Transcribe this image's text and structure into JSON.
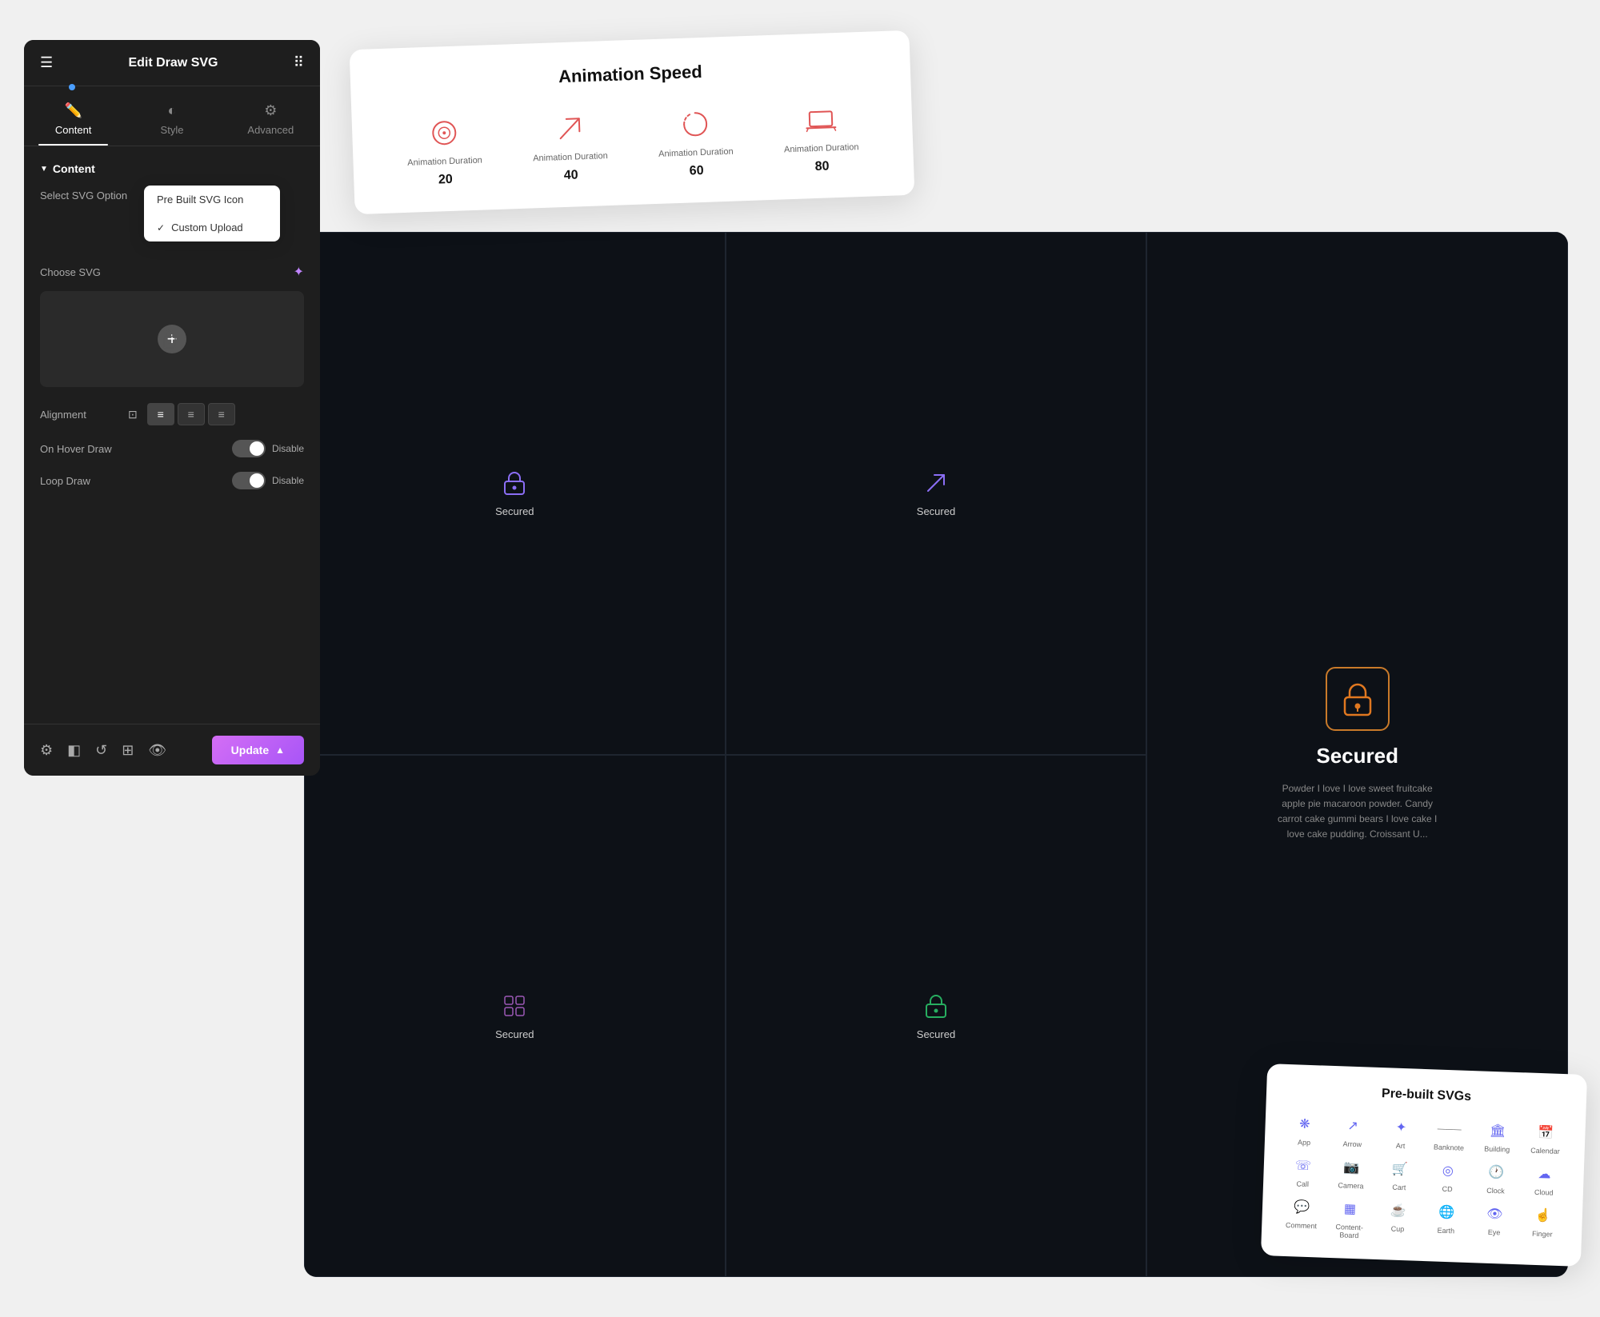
{
  "panel": {
    "title": "Edit Draw SVG",
    "tabs": [
      {
        "id": "content",
        "label": "Content",
        "icon": "✏️",
        "active": true
      },
      {
        "id": "style",
        "label": "Style",
        "icon": "◐"
      },
      {
        "id": "advanced",
        "label": "Advanced",
        "icon": "⚙️"
      }
    ],
    "content_section": {
      "title": "Content",
      "select_svg_label": "Select SVG Option",
      "dropdown_items": [
        {
          "label": "Pre Built SVG Icon",
          "selected": false
        },
        {
          "label": "Custom Upload",
          "selected": true
        }
      ],
      "choose_svg_label": "Choose SVG",
      "alignment_label": "Alignment",
      "alignment_options": [
        "left",
        "center",
        "right"
      ],
      "on_hover_draw_label": "On Hover Draw",
      "on_hover_draw_value": "Disable",
      "loop_draw_label": "Loop Draw",
      "loop_draw_value": "Disable"
    },
    "footer": {
      "update_label": "Update",
      "footer_icons": [
        "gear",
        "layers",
        "history",
        "frame",
        "eye"
      ]
    }
  },
  "animation_speed_card": {
    "title": "Animation Speed",
    "items": [
      {
        "label": "Animation Duration",
        "value": "20"
      },
      {
        "label": "Animation Duration",
        "value": "40"
      },
      {
        "label": "Animation Duration",
        "value": "60"
      },
      {
        "label": "Animation Duration",
        "value": "80"
      }
    ]
  },
  "dark_grid": {
    "cells": [
      {
        "label": "Secured",
        "icon_type": "lock-purple"
      },
      {
        "label": "Secured",
        "icon_type": "arrow-purple"
      },
      {
        "label": "Secured",
        "icon_type": "grid-purple"
      },
      {
        "label": "Secured",
        "icon_type": "user-green"
      }
    ],
    "featured": {
      "title": "Secured",
      "description": "Powder I love I love sweet fruitcake apple pie macaroon powder. Candy carrot cake gummi bears I love cake I love cake pudding. Croissant U...",
      "icon_type": "lock-orange"
    }
  },
  "prebuilt_card": {
    "title": "Pre-built SVGs",
    "items": [
      {
        "label": "App",
        "icon": "❋"
      },
      {
        "label": "Arrow",
        "icon": "↗"
      },
      {
        "label": "Art",
        "icon": "✦"
      },
      {
        "label": "Banknote",
        "icon": "—"
      },
      {
        "label": "Building",
        "icon": "🏛"
      },
      {
        "label": "Calendar",
        "icon": "📅"
      },
      {
        "label": "Call",
        "icon": "☎"
      },
      {
        "label": "Camera",
        "icon": "📷"
      },
      {
        "label": "Cart",
        "icon": "🛒"
      },
      {
        "label": "CD",
        "icon": "◎"
      },
      {
        "label": "Clock",
        "icon": "🕐"
      },
      {
        "label": "Cloud",
        "icon": "☁"
      },
      {
        "label": "Comment",
        "icon": "💬"
      },
      {
        "label": "Content-Board",
        "icon": "▦"
      },
      {
        "label": "Cup",
        "icon": "☕"
      },
      {
        "label": "Earth",
        "icon": "🌐"
      },
      {
        "label": "Eye",
        "icon": "👁"
      },
      {
        "label": "Finger",
        "icon": "☝"
      }
    ]
  }
}
